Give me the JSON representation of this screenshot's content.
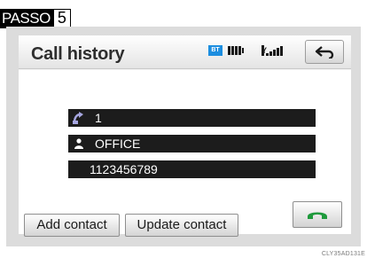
{
  "step": {
    "word": "PASSO",
    "number": "5"
  },
  "header": {
    "title": "Call history",
    "bluetooth_badge": "BT",
    "signal_prefix": "Y"
  },
  "entries": [
    {
      "icon": "phone-arrow-icon",
      "text": "1"
    },
    {
      "icon": "person-icon",
      "text": "OFFICE"
    },
    {
      "icon": "",
      "text": "1123456789"
    }
  ],
  "buttons": {
    "add_contact": "Add contact",
    "update_contact": "Update contact"
  },
  "image_code": "CLY35AD131E",
  "colors": {
    "bluetooth": "#1d8ee0",
    "call_green": "#1f9a3c",
    "row_bg": "#1c1c1c",
    "entry_icon": "#a6a6e0"
  }
}
